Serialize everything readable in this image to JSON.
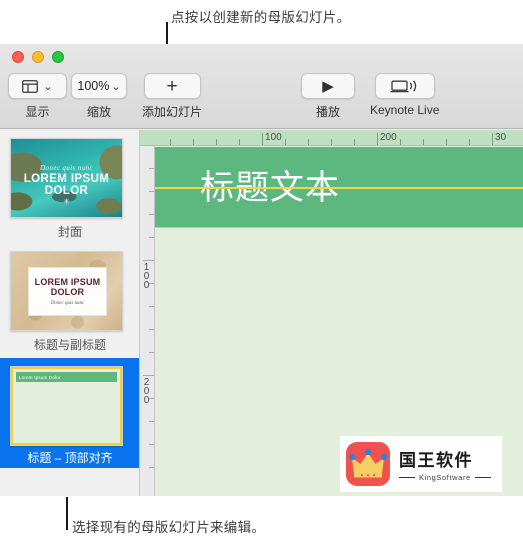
{
  "annotations": {
    "top": "点按以创建新的母版幻灯片。",
    "bottom": "选择现有的母版幻灯片来编辑。"
  },
  "window": {
    "traffic_lights": [
      "close-red",
      "minimize-yellow",
      "maximize-green"
    ],
    "toolbar": {
      "view": {
        "label": "显示",
        "icon": "view-panels-icon",
        "chevron": "⌄"
      },
      "zoom": {
        "label": "缩放",
        "value": "100%",
        "chevron": "⌄"
      },
      "add_slide": {
        "label": "添加幻灯片",
        "icon": "plus-icon",
        "glyph": "+"
      },
      "play": {
        "label": "播放",
        "icon": "play-triangle-icon",
        "glyph": "▶"
      },
      "keynote_live": {
        "label": "Keynote Live",
        "icon": "laptop-broadcast-icon",
        "glyph": "))"
      }
    }
  },
  "navigator": {
    "slides": [
      {
        "caption": "封面",
        "kind": "ocean",
        "script_text": "Donec quis nunc",
        "title_text": "LOREM IPSUM DOLOR",
        "ornament": "✳",
        "selected": false
      },
      {
        "caption": "标题与副标题",
        "kind": "map",
        "title_text": "LOREM IPSUM DOLOR",
        "script_text": "Donec quis nunc",
        "selected": false
      },
      {
        "caption": "标题 – 顶部对齐",
        "kind": "template",
        "bar_text": "Lorem Ipsum Dolor",
        "selected": true
      }
    ]
  },
  "canvas": {
    "title_placeholder": "标题文本",
    "ruler_h_labels": [
      "100",
      "200",
      "30"
    ],
    "ruler_v_labels": [
      "100",
      "200"
    ],
    "colors": {
      "title_band": "#5cb87f",
      "canvas_body": "#e4eedc",
      "guide_line": "#e8d84a",
      "selection_blue": "#0a74ef",
      "template_border": "#f2d034"
    }
  },
  "watermark": {
    "cn": "国王软件",
    "en": "KingSoftware",
    "mark": "crown-icon"
  }
}
